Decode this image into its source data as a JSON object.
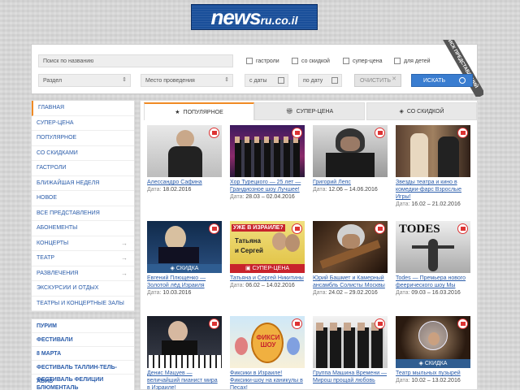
{
  "logo": {
    "main": "news",
    "sub": "ru.co.il"
  },
  "search": {
    "name_placeholder": "Поиск по названию",
    "ribbon": "ПОИСК ПРЕДСТАВЛЕНИЙ",
    "filters": [
      "гастроли",
      "со скидкой",
      "супер-цена",
      "для детей"
    ],
    "section_label": "Раздел",
    "venue_label": "Место проведения",
    "date_from": "с даты",
    "date_to": "по дату",
    "clear_label": "ОЧИСТИТЬ",
    "search_label": "ИСКАТЬ"
  },
  "sidebar": {
    "items": [
      {
        "label": "ГЛАВНАЯ"
      },
      {
        "label": "СУПЕР-ЦЕНА"
      },
      {
        "label": "ПОПУЛЯРНОЕ"
      },
      {
        "label": "СО СКИДКАМИ"
      },
      {
        "label": "ГАСТРОЛИ"
      },
      {
        "label": "БЛИЖАЙШАЯ НЕДЕЛЯ"
      },
      {
        "label": "НОВОЕ"
      },
      {
        "label": "ВСЕ ПРЕДСТАВЛЕНИЯ"
      },
      {
        "label": "АБОНЕМЕНТЫ"
      },
      {
        "label": "КОНЦЕРТЫ"
      },
      {
        "label": "ТЕАТР"
      },
      {
        "label": "РАЗВЛЕЧЕНИЯ"
      },
      {
        "label": "ЭКСКУРСИИ И ОТДЫХ"
      },
      {
        "label": "ТЕАТРЫ И КОНЦЕРТНЫЕ ЗАЛЫ"
      }
    ],
    "featured": [
      {
        "label": "ПУРИМ"
      },
      {
        "label": "ФЕСТИВАЛИ"
      },
      {
        "label": "8 МАРТА"
      },
      {
        "label": "ФЕСТИВАЛЬ ТАЛЛИН-ТЕЛЬ-АВИВ"
      },
      {
        "label": "ФЕСТИВАЛЬ ФЕЛИЦИИ БЛЮМЕНТАЛЬ"
      }
    ]
  },
  "tabs": [
    {
      "label": "ПОПУЛЯРНОЕ"
    },
    {
      "label": "СУПЕР-ЦЕНА"
    },
    {
      "label": "СО СКИДКОЙ"
    }
  ],
  "date_label": "Дата:",
  "cards": [
    {
      "title": "Алессандро Сафина",
      "date": "18.02.2016"
    },
    {
      "title": "Хор Турецкого — 25 лет — Грандиозное шоу Лучшее!",
      "date": "28.03 – 02.04.2016"
    },
    {
      "title": "Григорий Лепс",
      "date": "12.06 – 14.06.2016"
    },
    {
      "title": "Звезды театра и кино в комедии-фарс Взрослые Игры!",
      "date": "16.02 – 21.02.2016"
    },
    {
      "title": "Евгений Плющенко — Золотой лёд Израиля",
      "date": "10.03.2016",
      "badge": "СКИДКА"
    },
    {
      "title": "Татьяна и Сергей Никитины",
      "date": "06.02 – 14.02.2016",
      "badge": "СУПЕР-ЦЕНА"
    },
    {
      "title": "Юрий Башмет и Камерный ансамбль Солисты Москвы",
      "date": "24.02 – 29.02.2016"
    },
    {
      "title": "Todes — Премьера нового феерического шоу Мы",
      "date": "09.03 – 16.03.2016"
    },
    {
      "title": "Денис Мацуев — величайший пианист мира в Израиле!",
      "date": ""
    },
    {
      "title": "Фиксики в Израиле! Фиксики-шоу на каникулы в Песах!",
      "date": ""
    },
    {
      "title": "Группа Машина Времени — Мирош прощай любовь",
      "date": ""
    },
    {
      "title": "Театр мыльных пузырей",
      "date": "10.02 – 13.02.2016",
      "badge": "СКИДКА"
    }
  ],
  "thumb_texts": {
    "todes": "TODES",
    "uzhe": "УЖЕ В ИЗРАИЛЕ?",
    "tatyana": "Татьяна",
    "sergey": "и Сергей",
    "fiksi": "ФИКСИ ШОУ"
  },
  "colors": {
    "accent": "#f08a24",
    "link": "#2a5caa",
    "search_button": "#3a7dd0",
    "badge_discount": "#2f5d91",
    "badge_superprice": "#c8232c"
  }
}
